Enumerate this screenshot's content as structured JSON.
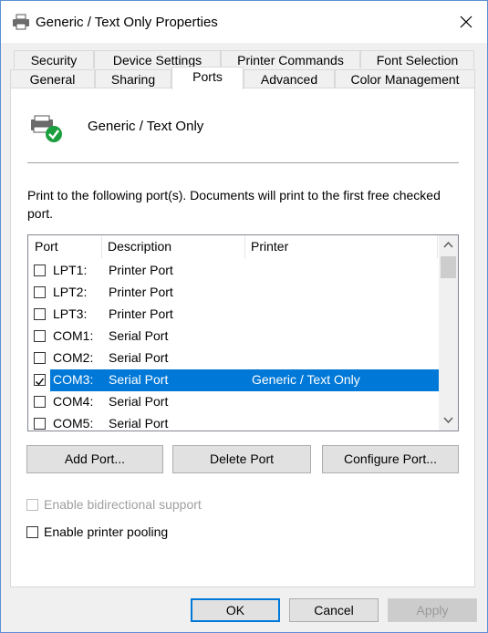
{
  "window": {
    "title": "Generic / Text Only Properties",
    "close_icon": "close-icon",
    "app_icon": "printer-icon"
  },
  "tabs": {
    "row1": [
      "Security",
      "Device Settings",
      "Printer Commands",
      "Font Selection"
    ],
    "row2": [
      "General",
      "Sharing",
      "Ports",
      "Advanced",
      "Color Management"
    ],
    "active": "Ports"
  },
  "printer": {
    "name": "Generic / Text Only",
    "icon": "printer-default-icon"
  },
  "description": "Print to the following port(s). Documents will print to the first free checked port.",
  "ports_table": {
    "columns": [
      "Port",
      "Description",
      "Printer"
    ],
    "rows": [
      {
        "port": "LPT1:",
        "description": "Printer Port",
        "printer": "",
        "checked": false,
        "selected": false
      },
      {
        "port": "LPT2:",
        "description": "Printer Port",
        "printer": "",
        "checked": false,
        "selected": false
      },
      {
        "port": "LPT3:",
        "description": "Printer Port",
        "printer": "",
        "checked": false,
        "selected": false
      },
      {
        "port": "COM1:",
        "description": "Serial Port",
        "printer": "",
        "checked": false,
        "selected": false
      },
      {
        "port": "COM2:",
        "description": "Serial Port",
        "printer": "",
        "checked": false,
        "selected": false
      },
      {
        "port": "COM3:",
        "description": "Serial Port",
        "printer": "Generic / Text Only",
        "checked": true,
        "selected": true
      },
      {
        "port": "COM4:",
        "description": "Serial Port",
        "printer": "",
        "checked": false,
        "selected": false
      },
      {
        "port": "COM5:",
        "description": "Serial Port",
        "printer": "",
        "checked": false,
        "selected": false
      }
    ]
  },
  "port_buttons": {
    "add": "Add Port...",
    "delete": "Delete Port",
    "configure": "Configure Port..."
  },
  "options": {
    "bidirectional": {
      "label": "Enable bidirectional support",
      "checked": false,
      "enabled": false
    },
    "pooling": {
      "label": "Enable printer pooling",
      "checked": false,
      "enabled": true
    }
  },
  "dialog_buttons": {
    "ok": "OK",
    "cancel": "Cancel",
    "apply": "Apply"
  },
  "colors": {
    "selection": "#0078d7",
    "window_border": "#5b8fd6"
  }
}
